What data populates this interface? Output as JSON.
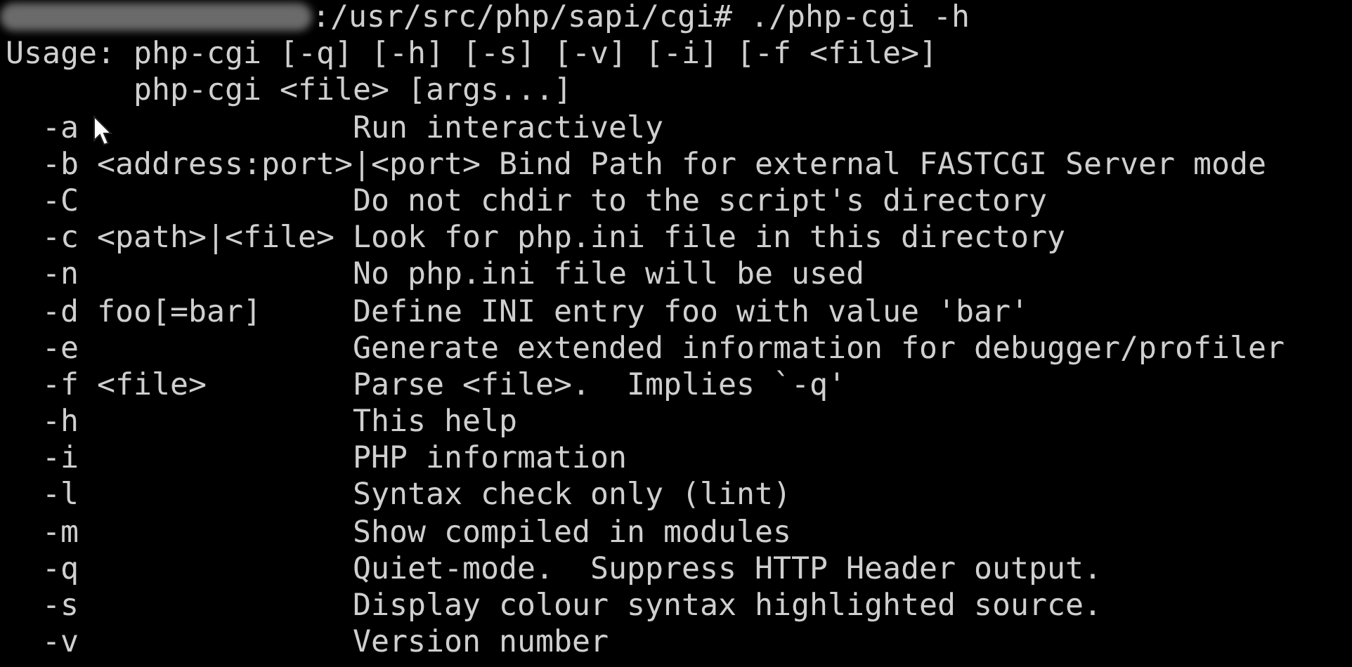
{
  "prompt": {
    "command": ":/usr/src/php/sapi/cgi# ./php-cgi -h"
  },
  "usage": [
    "Usage: php-cgi [-q] [-h] [-s] [-v] [-i] [-f <file>]",
    "       php-cgi <file> [args...]"
  ],
  "options": [
    {
      "flag": "-a",
      "description": "Run interactively"
    },
    {
      "flag": "-b <address:port>|<port>",
      "description": "Bind Path for external FASTCGI Server mode"
    },
    {
      "flag": "-C",
      "description": "Do not chdir to the script's directory"
    },
    {
      "flag": "-c <path>|<file>",
      "description": "Look for php.ini file in this directory"
    },
    {
      "flag": "-n",
      "description": "No php.ini file will be used"
    },
    {
      "flag": "-d foo[=bar]",
      "description": "Define INI entry foo with value 'bar'"
    },
    {
      "flag": "-e",
      "description": "Generate extended information for debugger/profiler"
    },
    {
      "flag": "-f <file>",
      "description": "Parse <file>.  Implies `-q'"
    },
    {
      "flag": "-h",
      "description": "This help"
    },
    {
      "flag": "-i",
      "description": "PHP information"
    },
    {
      "flag": "-l",
      "description": "Syntax check only (lint)"
    },
    {
      "flag": "-m",
      "description": "Show compiled in modules"
    },
    {
      "flag": "-q",
      "description": "Quiet-mode.  Suppress HTTP Header output."
    },
    {
      "flag": "-s",
      "description": "Display colour syntax highlighted source."
    },
    {
      "flag": "-v",
      "description": "Version number"
    }
  ]
}
